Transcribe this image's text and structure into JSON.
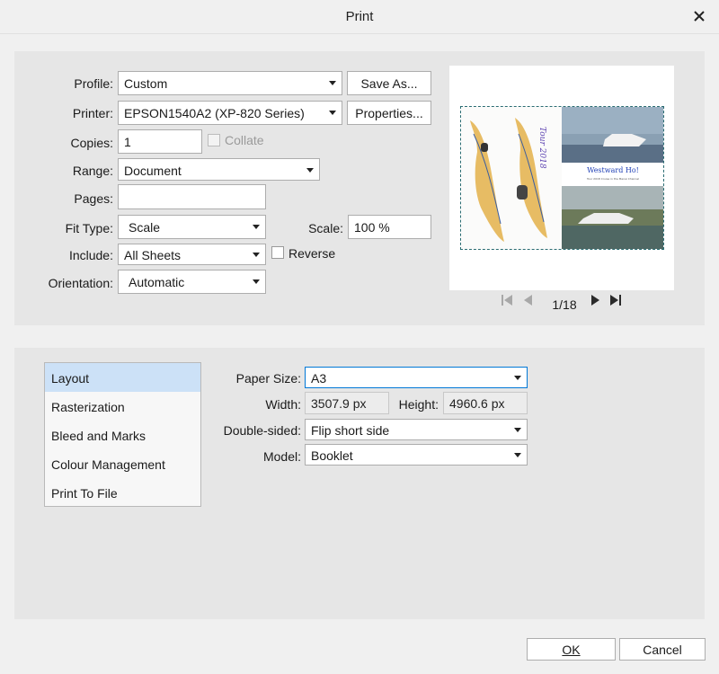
{
  "window": {
    "title": "Print"
  },
  "print": {
    "profile_label": "Profile:",
    "profile_value": "Custom",
    "save_as_label": "Save As...",
    "printer_label": "Printer:",
    "printer_value": "EPSON1540A2 (XP-820 Series)",
    "properties_label": "Properties...",
    "copies_label": "Copies:",
    "copies_value": "1",
    "collate_label": "Collate",
    "range_label": "Range:",
    "range_value": "Document",
    "pages_label": "Pages:",
    "pages_value": "",
    "fit_type_label": "Fit Type:",
    "fit_type_value": "Scale",
    "scale_label": "Scale:",
    "scale_value": "100 %",
    "include_label": "Include:",
    "include_value": "All Sheets",
    "reverse_label": "Reverse",
    "orientation_label": "Orientation:",
    "orientation_value": "Automatic"
  },
  "preview": {
    "page_indicator": "1/18",
    "map_title": "Tour 2018",
    "heading": "Westward Ho!",
    "subtitle": "Tour 2018 Cruise in the Menai Channel"
  },
  "sections": {
    "items": [
      "Layout",
      "Rasterization",
      "Bleed and Marks",
      "Colour Management",
      "Print To File"
    ],
    "selected": "Layout"
  },
  "layout": {
    "paper_size_label": "Paper Size:",
    "paper_size_value": "A3",
    "width_label": "Width:",
    "width_value": "3507.9 px",
    "height_label": "Height:",
    "height_value": "4960.6 px",
    "double_sided_label": "Double-sided:",
    "double_sided_value": "Flip short side",
    "model_label": "Model:",
    "model_value": "Booklet"
  },
  "footer": {
    "ok_label": "OK",
    "cancel_label": "Cancel"
  },
  "colors": {
    "panel": "#e6e6e6",
    "selection": "#cce1f7",
    "accent_border": "#2a6c72"
  }
}
